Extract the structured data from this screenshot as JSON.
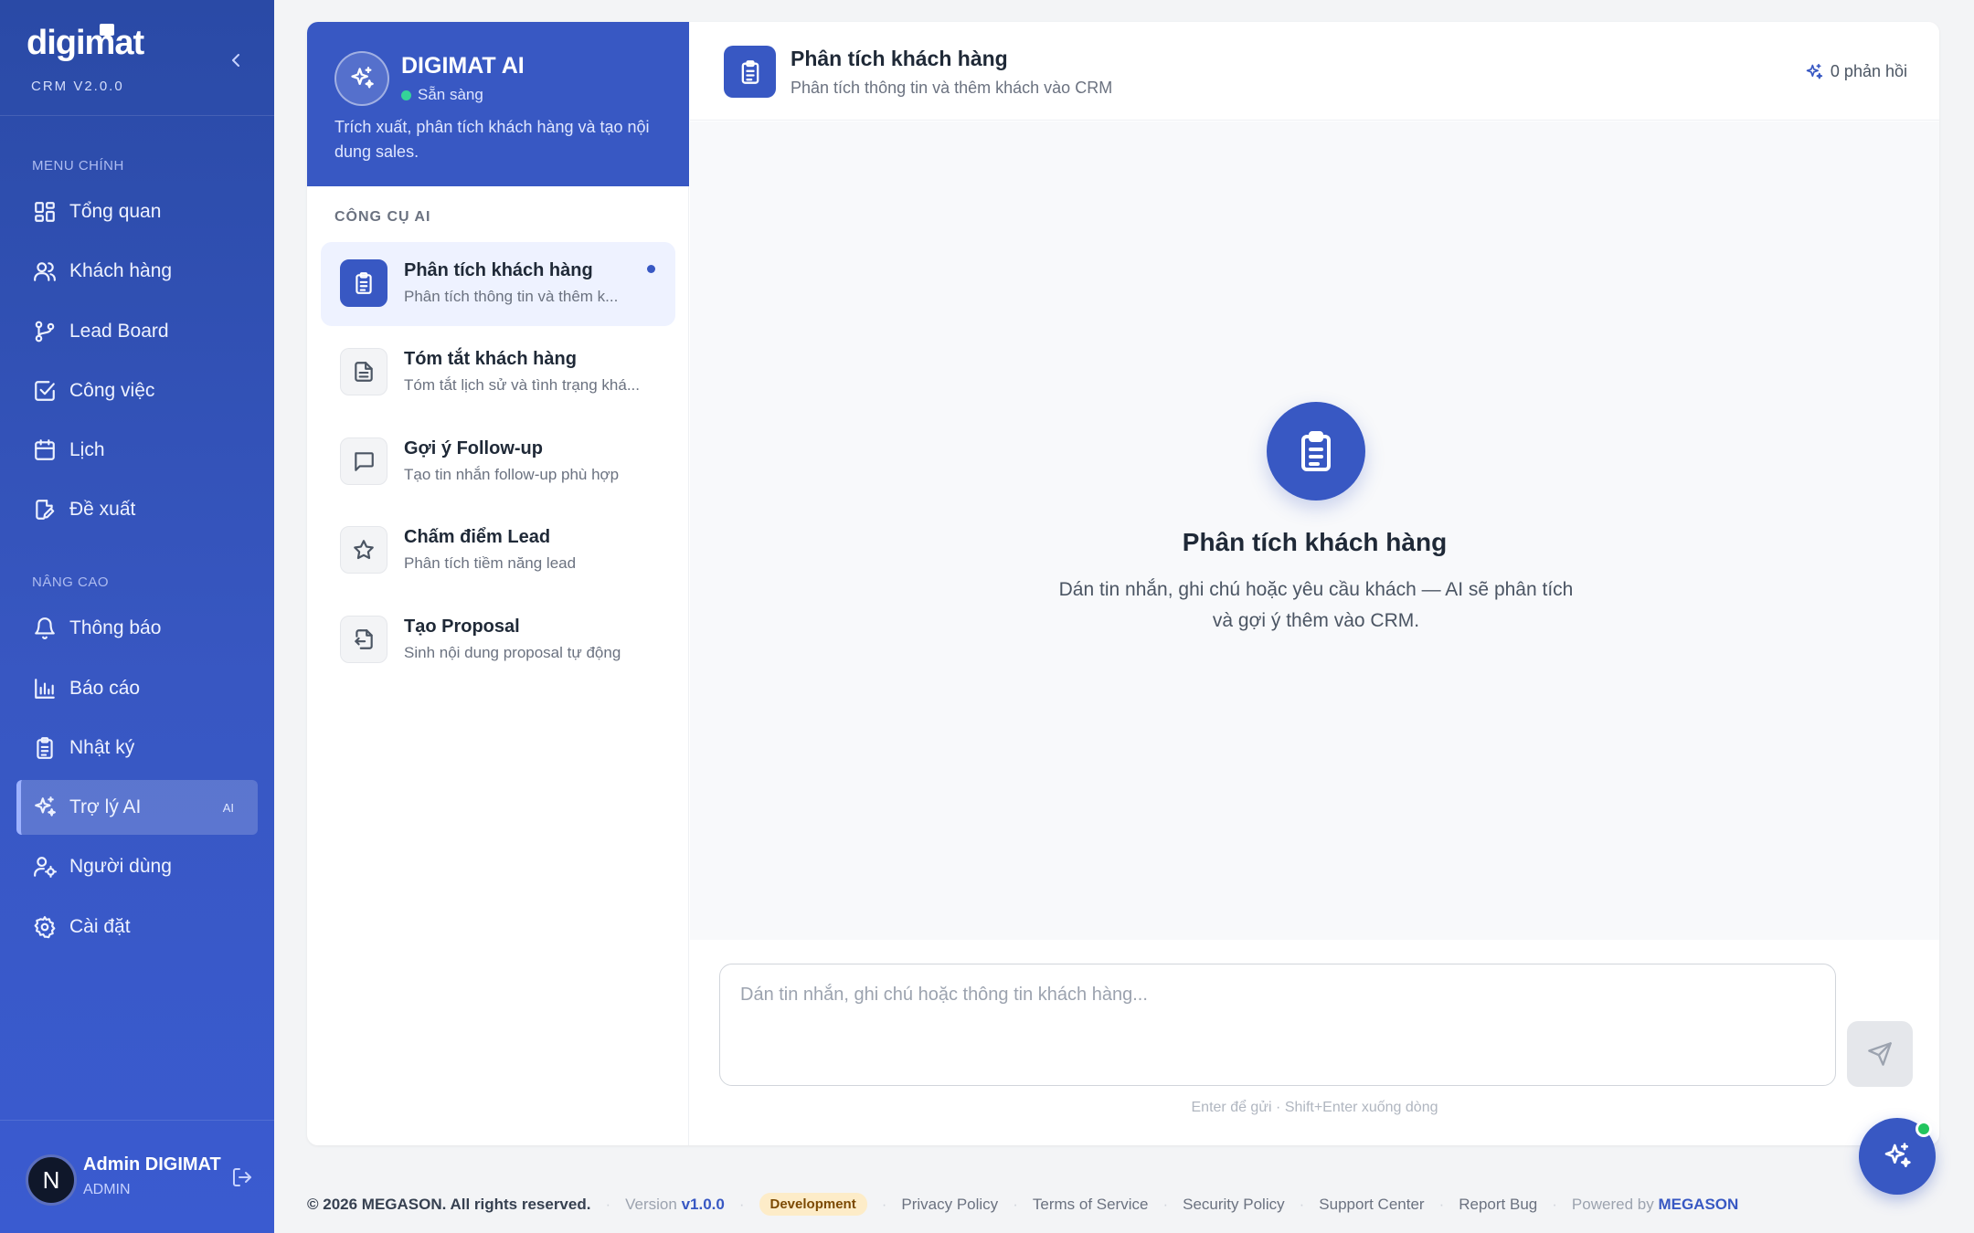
{
  "app": {
    "logo": "digimat",
    "version": "CRM V2.0.0"
  },
  "sidebar": {
    "main_label": "MENU CHÍNH",
    "main_items": [
      {
        "label": "Tổng quan",
        "icon": "grid-icon"
      },
      {
        "label": "Khách hàng",
        "icon": "users-icon"
      },
      {
        "label": "Lead Board",
        "icon": "git-branch-icon"
      },
      {
        "label": "Công việc",
        "icon": "checkbox-icon"
      },
      {
        "label": "Lịch",
        "icon": "calendar-icon"
      },
      {
        "label": "Đề xuất",
        "icon": "edit-doc-icon"
      }
    ],
    "advanced_label": "NÂNG CAO",
    "advanced_items": [
      {
        "label": "Thông báo",
        "icon": "bell-icon"
      },
      {
        "label": "Báo cáo",
        "icon": "bar-chart-icon"
      },
      {
        "label": "Nhật ký",
        "icon": "clipboard-icon"
      },
      {
        "label": "Trợ lý AI",
        "icon": "sparkles-icon",
        "active": true,
        "badge": "AI"
      },
      {
        "label": "Người dùng",
        "icon": "user-cog-icon"
      },
      {
        "label": "Cài đặt",
        "icon": "gear-icon"
      }
    ],
    "user": {
      "initial": "N",
      "name": "Admin DIGIMAT",
      "role": "ADMIN"
    }
  },
  "assistant": {
    "name": "DIGIMAT AI",
    "status": "Sẵn sàng",
    "description": "Trích xuất, phân tích khách hàng và tạo nội dung sales.",
    "tools_label": "CÔNG CỤ AI",
    "tools": [
      {
        "title": "Phân tích khách hàng",
        "subtitle": "Phân tích thông tin và thêm k...",
        "icon": "clipboard-icon",
        "active": true
      },
      {
        "title": "Tóm tắt khách hàng",
        "subtitle": "Tóm tắt lịch sử và tình trạng khá...",
        "icon": "document-icon"
      },
      {
        "title": "Gợi ý Follow-up",
        "subtitle": "Tạo tin nhắn follow-up phù hợp",
        "icon": "message-icon"
      },
      {
        "title": "Chấm điểm Lead",
        "subtitle": "Phân tích tiềm năng lead",
        "icon": "star-icon"
      },
      {
        "title": "Tạo Proposal",
        "subtitle": "Sinh nội dung proposal tự động",
        "icon": "file-import-icon"
      }
    ]
  },
  "chat": {
    "title": "Phân tích khách hàng",
    "subtitle": "Phân tích thông tin và thêm khách vào CRM",
    "responses": "0 phản hồi",
    "empty_title": "Phân tích khách hàng",
    "empty_desc": "Dán tin nhắn, ghi chú hoặc yêu cầu khách — AI sẽ phân tích và gợi ý thêm vào CRM.",
    "input_placeholder": "Dán tin nhắn, ghi chú hoặc thông tin khách hàng...",
    "hint": "Enter để gửi · Shift+Enter xuống dòng"
  },
  "footer": {
    "copyright": "© 2026 MEGASON. All rights reserved.",
    "version_label": "Version",
    "version": "v1.0.0",
    "env": "Development",
    "links": [
      "Privacy Policy",
      "Terms of Service",
      "Security Policy",
      "Support Center",
      "Report Bug"
    ],
    "powered_label": "Powered by",
    "powered_brand": "MEGASON"
  },
  "colors": {
    "primary": "#3858c3",
    "sidebar": "#2a4aa6",
    "status_green": "#34d399",
    "dev_badge": "#fdecc8"
  }
}
